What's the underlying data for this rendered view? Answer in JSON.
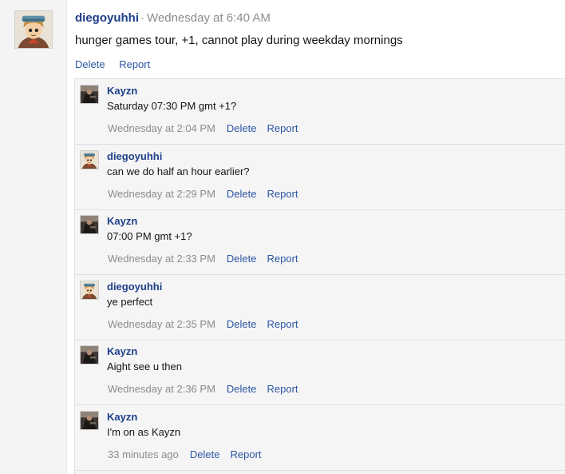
{
  "post": {
    "author": "diegoyuhhi",
    "separator": "·",
    "time": "Wednesday at 6:40 AM",
    "message": "hunger games tour, +1, cannot play during weekday mornings",
    "delete_label": "Delete",
    "report_label": "Report"
  },
  "comments": [
    {
      "author": "Kayzn",
      "avatar": "kayzn-avatar",
      "text": "Saturday 07:30 PM gmt +1?",
      "time": "Wednesday at 2:04 PM",
      "delete_label": "Delete",
      "report_label": "Report"
    },
    {
      "author": "diegoyuhhi",
      "avatar": "diegoyuhhi-avatar",
      "text": "can we do half an hour earlier?",
      "time": "Wednesday at 2:29 PM",
      "delete_label": "Delete",
      "report_label": "Report"
    },
    {
      "author": "Kayzn",
      "avatar": "kayzn-avatar",
      "text": "07:00 PM gmt +1?",
      "time": "Wednesday at 2:33 PM",
      "delete_label": "Delete",
      "report_label": "Report"
    },
    {
      "author": "diegoyuhhi",
      "avatar": "diegoyuhhi-avatar",
      "text": "ye perfect",
      "time": "Wednesday at 2:35 PM",
      "delete_label": "Delete",
      "report_label": "Report"
    },
    {
      "author": "Kayzn",
      "avatar": "kayzn-avatar",
      "text": "Aight see u then",
      "time": "Wednesday at 2:36 PM",
      "delete_label": "Delete",
      "report_label": "Report"
    },
    {
      "author": "Kayzn",
      "avatar": "kayzn-avatar",
      "text": "I'm on as Kayzn",
      "time": "33 minutes ago",
      "delete_label": "Delete",
      "report_label": "Report"
    }
  ],
  "colors": {
    "username": "#1e3f8a",
    "link": "#2d56a4",
    "muted": "#8c8c8c",
    "comment_bg": "#f5f5f5"
  }
}
